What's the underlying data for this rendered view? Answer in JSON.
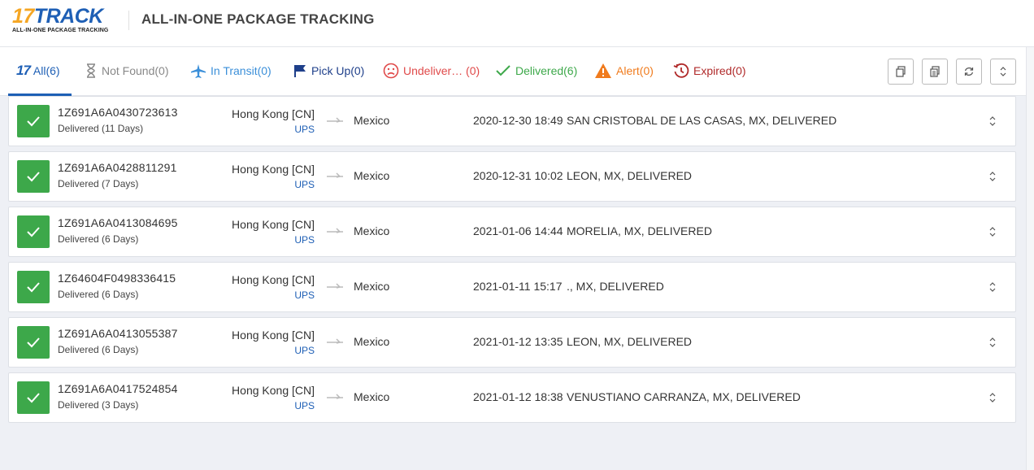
{
  "logo": {
    "main_17": "17",
    "main_track": "TRACK",
    "sub": "ALL-IN-ONE PACKAGE TRACKING"
  },
  "header": {
    "title": "ALL-IN-ONE PACKAGE TRACKING"
  },
  "tabs": [
    {
      "label": "All(6)",
      "color": "#1e5fb5"
    },
    {
      "label": "Not Found(0)",
      "color": "#888888"
    },
    {
      "label": "In Transit(0)",
      "color": "#3b8fd9"
    },
    {
      "label": "Pick Up(0)",
      "color": "#1e3f8a"
    },
    {
      "label": "Undeliver… (0)",
      "color": "#e04a4a"
    },
    {
      "label": "Delivered(6)",
      "color": "#3da84a"
    },
    {
      "label": "Alert(0)",
      "color": "#f07b1d"
    },
    {
      "label": "Expired(0)",
      "color": "#b02a2a"
    }
  ],
  "tools": [
    "copy-icon",
    "clipboard-icon",
    "refresh-icon",
    "expand-all-icon"
  ],
  "shipments": [
    {
      "tracking": "1Z691A6A0430723613",
      "status": "Delivered (11 Days)",
      "origin": "Hong Kong [CN]",
      "carrier": "UPS",
      "destination": "Mexico",
      "time": "2020-12-30 18:49",
      "event": "SAN CRISTOBAL DE LAS CASAS, MX, DELIVERED"
    },
    {
      "tracking": "1Z691A6A0428811291",
      "status": "Delivered (7 Days)",
      "origin": "Hong Kong [CN]",
      "carrier": "UPS",
      "destination": "Mexico",
      "time": "2020-12-31 10:02",
      "event": "LEON, MX, DELIVERED"
    },
    {
      "tracking": "1Z691A6A0413084695",
      "status": "Delivered (6 Days)",
      "origin": "Hong Kong [CN]",
      "carrier": "UPS",
      "destination": "Mexico",
      "time": "2021-01-06 14:44",
      "event": "MORELIA, MX, DELIVERED"
    },
    {
      "tracking": "1Z64604F0498336415",
      "status": "Delivered (6 Days)",
      "origin": "Hong Kong [CN]",
      "carrier": "UPS",
      "destination": "Mexico",
      "time": "2021-01-11 15:17",
      "event": "., MX, DELIVERED"
    },
    {
      "tracking": "1Z691A6A0413055387",
      "status": "Delivered (6 Days)",
      "origin": "Hong Kong [CN]",
      "carrier": "UPS",
      "destination": "Mexico",
      "time": "2021-01-12 13:35",
      "event": "LEON, MX, DELIVERED"
    },
    {
      "tracking": "1Z691A6A0417524854",
      "status": "Delivered (3 Days)",
      "origin": "Hong Kong [CN]",
      "carrier": "UPS",
      "destination": "Mexico",
      "time": "2021-01-12 18:38",
      "event": "VENUSTIANO CARRANZA, MX, DELIVERED"
    }
  ]
}
